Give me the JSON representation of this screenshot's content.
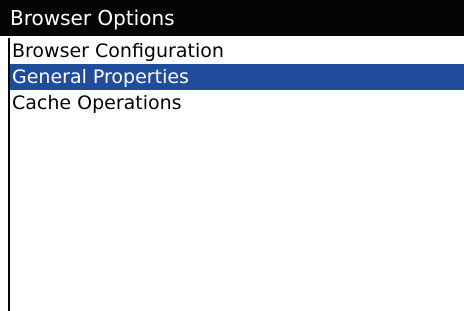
{
  "window": {
    "title": "Browser Options"
  },
  "menu": {
    "items": [
      {
        "label": "Browser Configuration",
        "selected": false
      },
      {
        "label": "General Properties",
        "selected": true
      },
      {
        "label": "Cache Operations",
        "selected": false
      }
    ]
  },
  "colors": {
    "title_bar_bg": "#050505",
    "title_text": "#ffffff",
    "selection_bg": "#1f4d9b",
    "selection_text": "#ffffff",
    "item_text": "#000000",
    "background": "#ffffff"
  }
}
